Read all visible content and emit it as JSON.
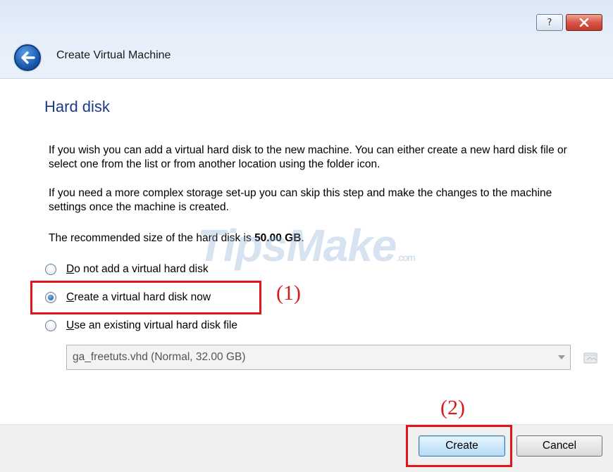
{
  "window": {
    "title": "Create Virtual Machine",
    "help_glyph": "?",
    "close_glyph": "x"
  },
  "page": {
    "heading": "Hard disk",
    "paragraph1": "If you wish you can add a virtual hard disk to the new machine. You can either create a new hard disk file or select one from the list or from another location using the folder icon.",
    "paragraph2": "If you need a more complex storage set-up you can skip this step and make the changes to the machine settings once the machine is created.",
    "recommended_prefix": "The recommended size of the hard disk is ",
    "recommended_size": "50.00 GB",
    "recommended_suffix": "."
  },
  "watermark": {
    "text": "TipsMake",
    "suffix": ".com"
  },
  "options": [
    {
      "mnemonic": "D",
      "rest": "o not add a virtual hard disk",
      "checked": false
    },
    {
      "mnemonic": "C",
      "rest": "reate a virtual hard disk now",
      "checked": true
    },
    {
      "mnemonic": "U",
      "rest": "se an existing virtual hard disk file",
      "checked": false
    }
  ],
  "disk_select": {
    "value": "ga_freetuts.vhd (Normal, 32.00 GB)",
    "arrow_icon": "chevron-down-icon",
    "folder_icon": "folder-icon"
  },
  "annotations": {
    "step1": "(1)",
    "step2": "(2)",
    "highlight_color": "#e0161c"
  },
  "buttons": {
    "create": "Create",
    "cancel": "Cancel"
  },
  "colors": {
    "heading": "#1e3a8a",
    "annotation": "#d61b1b",
    "chrome": "#dbe8f7"
  }
}
